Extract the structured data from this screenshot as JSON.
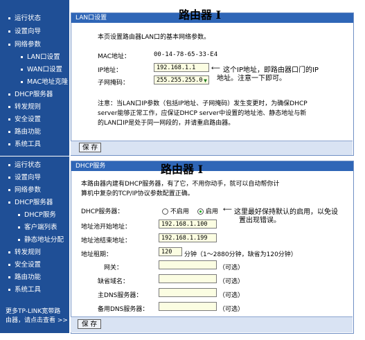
{
  "top": {
    "sidebar": [
      "运行状态",
      "设置向导",
      "网络参数",
      "LAN口设置",
      "WAN口设置",
      "MAC地址克隆",
      "DHCP服务器",
      "转发规则",
      "安全设置",
      "路由功能",
      "系统工具"
    ],
    "panel_header": "LAN口设置",
    "title": "路由器 I",
    "description": "本页设置路由器LAN口的基本网络参数。",
    "mac_label": "MAC地址：",
    "mac_value": "00-14-78-65-33-E4",
    "ip_label": "IP地址：",
    "ip_value": "192.168.1.1",
    "mask_label": "子网掩码：",
    "mask_value": "255.255.255.0",
    "annotation_line1": "这个IP地址，即路由器口门的IP",
    "annotation_line2": "地址。注意一下即可。",
    "note_line1": "注意：当LAN口IP参数（包括IP地址、子网掩码）发生变更时，为确保DHCP",
    "note_line2": "server能够正常工作，应保证DHCP server中设置的地址池、静态地址与新",
    "note_line3": "的LAN口IP是处于同一网段的，并请重启路由器。",
    "save_label": "保 存"
  },
  "bottom": {
    "sidebar": [
      "运行状态",
      "设置向导",
      "网络参数",
      "DHCP服务器",
      "DHCP服务",
      "客户端列表",
      "静态地址分配",
      "转发规则",
      "安全设置",
      "路由功能",
      "系统工具"
    ],
    "panel_header": "DHCP服务",
    "title": "路由器 I",
    "description_line1": "本路由器内建有DHCP服务器，有了它，不用你动手，就可以自动帮你计",
    "description_line2": "算机中复杂的TCP/IP协议参数配置正确。",
    "dhcp_label": "DHCP服务器：",
    "radio_off": "不启用",
    "radio_on": "启用",
    "radio_note_line1": "这里最好保持默认的启用，以免设",
    "radio_note_line2": "置出现错误。",
    "start_label": "地址池开始地址：",
    "start_value": "192.168.1.100",
    "end_label": "地址池结束地址：",
    "end_value": "192.168.1.199",
    "lease_label": "地址租期：",
    "lease_value": "120",
    "lease_unit": "分钟（1～2880分钟，缺省为120分钟）",
    "gateway_label": "网关：",
    "domain_label": "缺省域名：",
    "dns1_label": "主DNS服务器：",
    "dns2_label": "备用DNS服务器：",
    "optional": "（可选）",
    "promo_line1": "更多TP-LINK宽带路",
    "promo_line2": "由器，请点击查看 >>",
    "save_label": "保 存"
  }
}
